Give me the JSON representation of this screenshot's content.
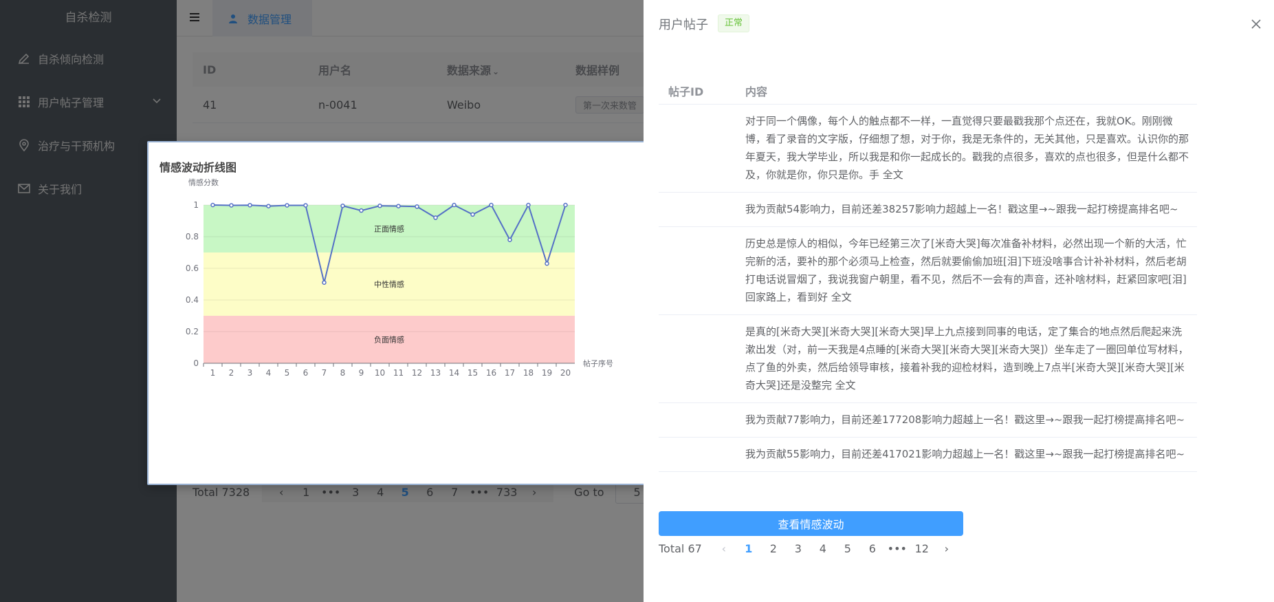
{
  "sidebar": {
    "brand": "自杀检测",
    "items": [
      {
        "label": "自杀倾向检测",
        "icon": "pencil-icon"
      },
      {
        "label": "用户帖子管理",
        "icon": "grid-icon"
      },
      {
        "label": "治疗与干预机构",
        "icon": "location-icon"
      },
      {
        "label": "关于我们",
        "icon": "mail-icon"
      }
    ]
  },
  "header": {
    "tab_label": "数据管理"
  },
  "table": {
    "columns": [
      "ID",
      "用户名",
      "数据来源",
      "数据样例"
    ],
    "rows": [
      {
        "id": "41",
        "username": "n-0041",
        "source": "Weibo",
        "sample": "第一次来数管"
      }
    ]
  },
  "main_pagination": {
    "total": "Total 7328",
    "pages": [
      "‹",
      "1",
      "•••",
      "3",
      "4",
      "5",
      "6",
      "7",
      "•••",
      "733",
      "›"
    ],
    "active": "5",
    "goto_label": "Go to",
    "goto_value": "5"
  },
  "drawer": {
    "title": "用户帖子",
    "status": "正常",
    "columns": [
      "帖子ID",
      "内容"
    ],
    "posts": [
      {
        "id": "",
        "content": "对于同一个偶像，每个人的触点都不一样，一直觉得只要最戳我那个点还在，我就OK。刚刚微博，看了录音的文字版，仔细想了想，对于你，我是无条件的，无关其他，只是喜欢。认识你的那年夏天，我大学毕业，所以我是和你一起成长的。戳我的点很多，喜欢的点也很多，但是什么都不及，你就是你，你只是你。手 全文"
      },
      {
        "id": "",
        "content": "我为贡献54影响力，目前还差38257影响力超越上一名！戳这里→~跟我一起打榜提高排名吧~"
      },
      {
        "id": "",
        "content": "历史总是惊人的相似，今年已经第三次了[米奇大哭]每次准备补材料，必然出现一个新的大活，忙完新的活，要补的那个必须马上检查，然后就要偷偷加班[泪]下班没啥事合计补补材料，然后老胡打电话说冒烟了，我说我窗户朝里，看不见，然后不一会有的声音，还补啥材料，赶紧回家吧[泪]回家路上，看到好 全文"
      },
      {
        "id": "",
        "content": "是真的[米奇大哭][米奇大哭][米奇大哭]早上九点接到同事的电话，定了集合的地点然后爬起来洗漱出发（对，前一天我是4点睡的[米奇大哭][米奇大哭][米奇大哭]）坐车走了一圈回单位写材料，点了鱼的外卖，然后给领导审核，接着补我的迎检材料，造到晚上7点半[米奇大哭][米奇大哭][米奇大哭]还是没整完 全文"
      },
      {
        "id": "",
        "content": "我为贡献77影响力，目前还差177208影响力超越上一名！戳这里→~跟我一起打榜提高排名吧~"
      },
      {
        "id": "",
        "content": "我为贡献55影响力，目前还差417021影响力超越上一名！戳这里→~跟我一起打榜提高排名吧~"
      }
    ],
    "button_label": "查看情感波动",
    "pagination": {
      "total": "Total 67",
      "pages": [
        "1",
        "2",
        "3",
        "4",
        "5",
        "6",
        "•••",
        "12"
      ],
      "active": "1"
    }
  },
  "modal": {
    "close_button": "关闭"
  },
  "chart_data": {
    "type": "line",
    "title": "情感波动折线图",
    "ylabel": "情感分数",
    "xlabel": "帖子序号",
    "x": [
      1,
      2,
      3,
      4,
      5,
      6,
      7,
      8,
      9,
      10,
      11,
      12,
      13,
      14,
      15,
      16,
      17,
      18,
      19,
      20
    ],
    "series": [
      {
        "values": [
          1.0,
          0.998,
          0.999,
          0.993,
          0.998,
          0.998,
          0.51,
          0.995,
          0.965,
          0.995,
          0.993,
          0.99,
          0.92,
          1.0,
          0.94,
          1.0,
          0.78,
          1.0,
          0.63,
          1.0
        ]
      }
    ],
    "ylim": [
      0,
      1
    ],
    "yticks": [
      0,
      0.2,
      0.4,
      0.6,
      0.8,
      1
    ],
    "bands": [
      {
        "label": "正面情感",
        "from": 0.7,
        "to": 1.0,
        "color": "#c8f7c5"
      },
      {
        "label": "中性情感",
        "from": 0.3,
        "to": 0.7,
        "color": "#fdfdc7"
      },
      {
        "label": "负面情感",
        "from": 0.0,
        "to": 0.3,
        "color": "#fdcbcb"
      }
    ],
    "line_color": "#5470c6",
    "grid": true
  }
}
